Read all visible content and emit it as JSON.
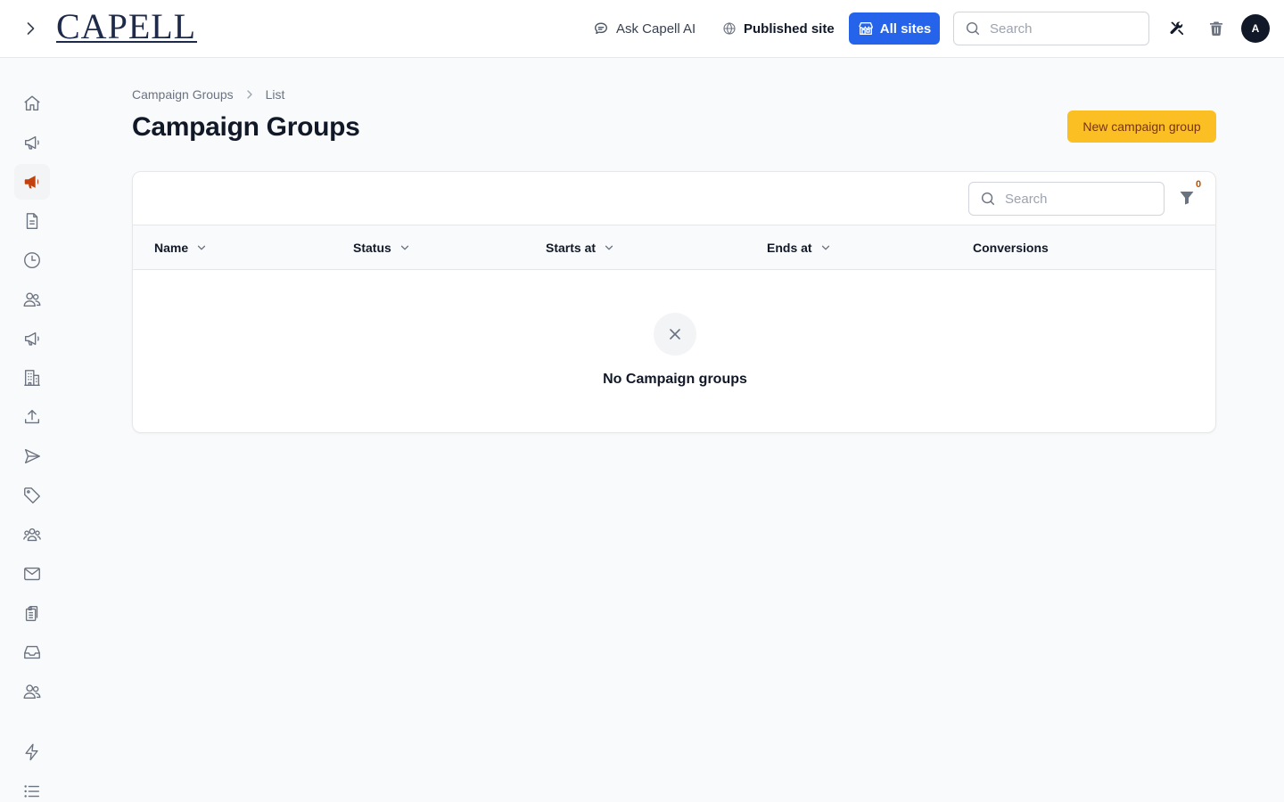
{
  "topbar": {
    "logo_text": "CAPELL",
    "ask_ai_label": "Ask Capell AI",
    "published_site_label": "Published site",
    "all_sites_label": "All sites",
    "search_placeholder": "Search",
    "avatar_initial": "A"
  },
  "sidebar": {
    "items": [
      {
        "name": "home-icon"
      },
      {
        "name": "megaphone-icon"
      },
      {
        "name": "megaphone-filled-icon",
        "active": true
      },
      {
        "name": "document-icon"
      },
      {
        "name": "clock-icon"
      },
      {
        "name": "users-icon"
      },
      {
        "name": "megaphone-icon"
      },
      {
        "name": "building-icon"
      },
      {
        "name": "upload-icon"
      },
      {
        "name": "send-icon"
      },
      {
        "name": "tag-icon"
      },
      {
        "name": "user-group-icon"
      },
      {
        "name": "mail-icon"
      },
      {
        "name": "clipboard-icon"
      },
      {
        "name": "inbox-icon"
      },
      {
        "name": "users-icon"
      },
      {
        "name": "bolt-icon"
      },
      {
        "name": "list-icon"
      }
    ],
    "active_color": "#c2410c"
  },
  "breadcrumb": {
    "items": [
      "Campaign Groups",
      "List"
    ]
  },
  "page": {
    "title": "Campaign Groups",
    "new_button_label": "New campaign group"
  },
  "table": {
    "search_placeholder": "Search",
    "filter_count": "0",
    "columns": [
      {
        "label": "Name",
        "sortable": true
      },
      {
        "label": "Status",
        "sortable": true
      },
      {
        "label": "Starts at",
        "sortable": true
      },
      {
        "label": "Ends at",
        "sortable": true
      },
      {
        "label": "Conversions",
        "sortable": false
      }
    ],
    "rows": [],
    "empty_text": "No Campaign groups"
  },
  "colors": {
    "primary": "#2563eb",
    "accent": "#fbbf24",
    "accent_text": "#78350f"
  }
}
